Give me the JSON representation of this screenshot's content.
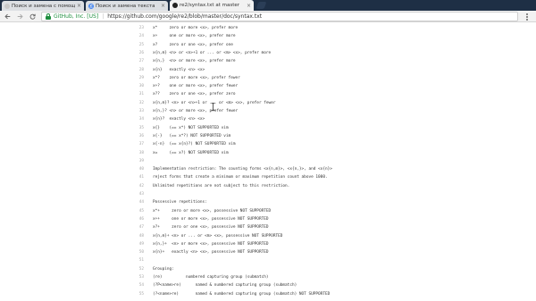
{
  "browser": {
    "tabs": [
      {
        "label": "Поиск и замена с помощ",
        "close": "×",
        "active": false
      },
      {
        "label": "Поиск и замена текста",
        "close": "×",
        "active": false
      },
      {
        "label": "re2/syntax.txt at master",
        "close": "×",
        "active": true
      }
    ],
    "origin": "GitHub, Inc. [US]",
    "separator": "|",
    "url": "https://github.com/google/re2/blob/master/doc/syntax.txt"
  },
  "document": {
    "lines": [
      {
        "n": "23",
        "text": "x*     zero or more <x>, prefer more"
      },
      {
        "n": "24",
        "text": "x+     one or more <x>, prefer more"
      },
      {
        "n": "25",
        "text": "x?     zero or one <x>, prefer one"
      },
      {
        "n": "26",
        "text": "x{n,m} <n> or <n>+1 or ... or <m> <x>, prefer more"
      },
      {
        "n": "27",
        "text": "x{n,}  <n> or more <x>, prefer more"
      },
      {
        "n": "28",
        "text": "x{n}   exactly <n> <x>"
      },
      {
        "n": "29",
        "text": "x*?    zero or more <x>, prefer fewer"
      },
      {
        "n": "30",
        "text": "x+?    one or more <x>, prefer fewer"
      },
      {
        "n": "31",
        "text": "x??    zero or one <x>, prefer zero"
      },
      {
        "n": "32",
        "text": "x{n,m}? <n> or <n>+1 or ... or <m> <x>, prefer fewer"
      },
      {
        "n": "33",
        "text": "x{n,}? <n> or more <x>, prefer fewer"
      },
      {
        "n": "34",
        "text": "x{n}?  exactly <n> <x>"
      },
      {
        "n": "35",
        "text": "x{}    (== x*) NOT SUPPORTED vim"
      },
      {
        "n": "36",
        "text": "x{-}   (== x*?) NOT SUPPORTED vim"
      },
      {
        "n": "37",
        "text": "x{-n}  (== x{n}?) NOT SUPPORTED vim"
      },
      {
        "n": "38",
        "text": "x=     (== x?) NOT SUPPORTED vim"
      },
      {
        "n": "39",
        "text": ""
      },
      {
        "n": "40",
        "text": "Implementation restriction: The counting forms <x{n,m}>, <x{n,}>, and <x{n}>"
      },
      {
        "n": "41",
        "text": "reject forms that create a minimum or maximum repetition count above 1000."
      },
      {
        "n": "42",
        "text": "Unlimited repetitions are not subject to this restriction."
      },
      {
        "n": "43",
        "text": ""
      },
      {
        "n": "44",
        "text": "Possessive repetitions:"
      },
      {
        "n": "45",
        "text": "x*+     zero or more <x>, possessive NOT SUPPORTED"
      },
      {
        "n": "46",
        "text": "x++     one or more <x>, possessive NOT SUPPORTED"
      },
      {
        "n": "47",
        "text": "x?+     zero or one <x>, possessive NOT SUPPORTED"
      },
      {
        "n": "48",
        "text": "x{n,m}+ <n> or ... or <m> <x>, possessive NOT SUPPORTED"
      },
      {
        "n": "49",
        "text": "x{n,}+  <n> or more <x>, possessive NOT SUPPORTED"
      },
      {
        "n": "50",
        "text": "x{n}+   exactly <n> <x>, possessive NOT SUPPORTED"
      },
      {
        "n": "51",
        "text": ""
      },
      {
        "n": "52",
        "text": "Grouping:"
      },
      {
        "n": "53",
        "text": "(re)          numbered capturing group (submatch)"
      },
      {
        "n": "54",
        "text": "(?P<name>re)      named & numbered capturing group (submatch)"
      },
      {
        "n": "55",
        "text": "(?<name>re)       named & numbered capturing group (submatch) NOT SUPPORTED"
      }
    ]
  },
  "icons": {
    "back": "arrow-left-icon",
    "forward": "arrow-right-icon",
    "reload": "reload-icon",
    "secure": "lock-icon",
    "menu": "more-vert-icon"
  }
}
